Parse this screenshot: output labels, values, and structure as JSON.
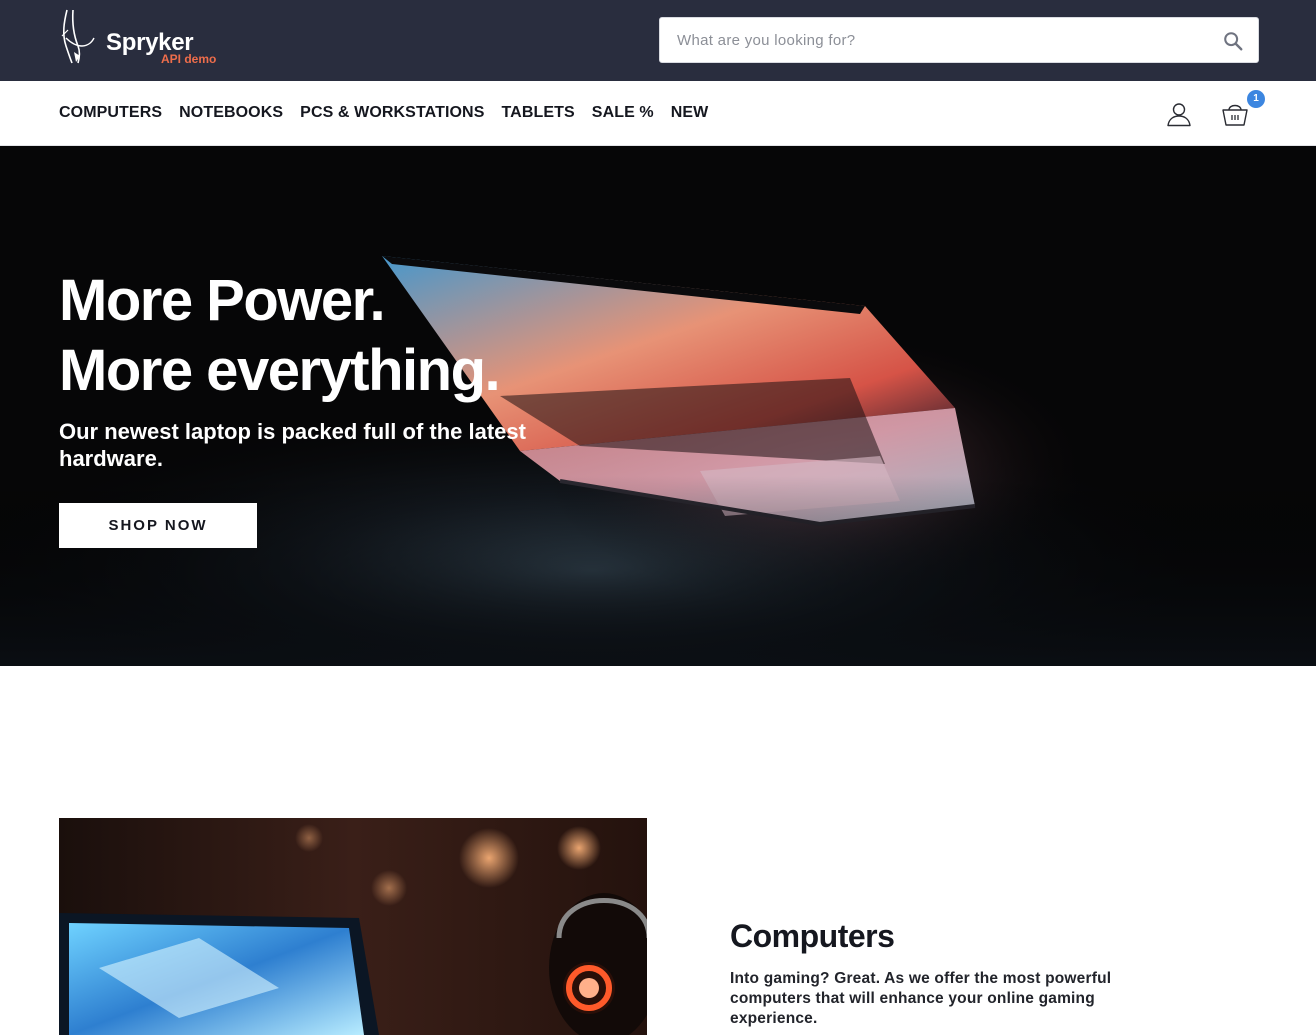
{
  "brand": {
    "name": "Spryker",
    "subtitle": "API demo"
  },
  "search": {
    "placeholder": "What are you looking for?",
    "icon": "search-icon"
  },
  "nav": {
    "items": [
      {
        "label": "COMPUTERS"
      },
      {
        "label": "NOTEBOOKS"
      },
      {
        "label": "PCS & WORKSTATIONS"
      },
      {
        "label": "TABLETS"
      },
      {
        "label": "SALE %"
      },
      {
        "label": "NEW"
      }
    ]
  },
  "account": {
    "icon": "user-icon"
  },
  "cart": {
    "icon": "cart-icon",
    "count": "1"
  },
  "hero": {
    "title_line1": "More Power.",
    "title_line2": "More everything.",
    "subtitle": "Our newest laptop is packed full of the latest hardware.",
    "button_label": "SHOP NOW"
  },
  "category": {
    "title": "Computers",
    "text": "Into gaming? Great. As we offer the most powerful computers that will enhance your online gaming experience."
  },
  "colors": {
    "header_bg": "#292d3e",
    "brand_accent": "#ee6d4b",
    "badge": "#3c86e0"
  }
}
